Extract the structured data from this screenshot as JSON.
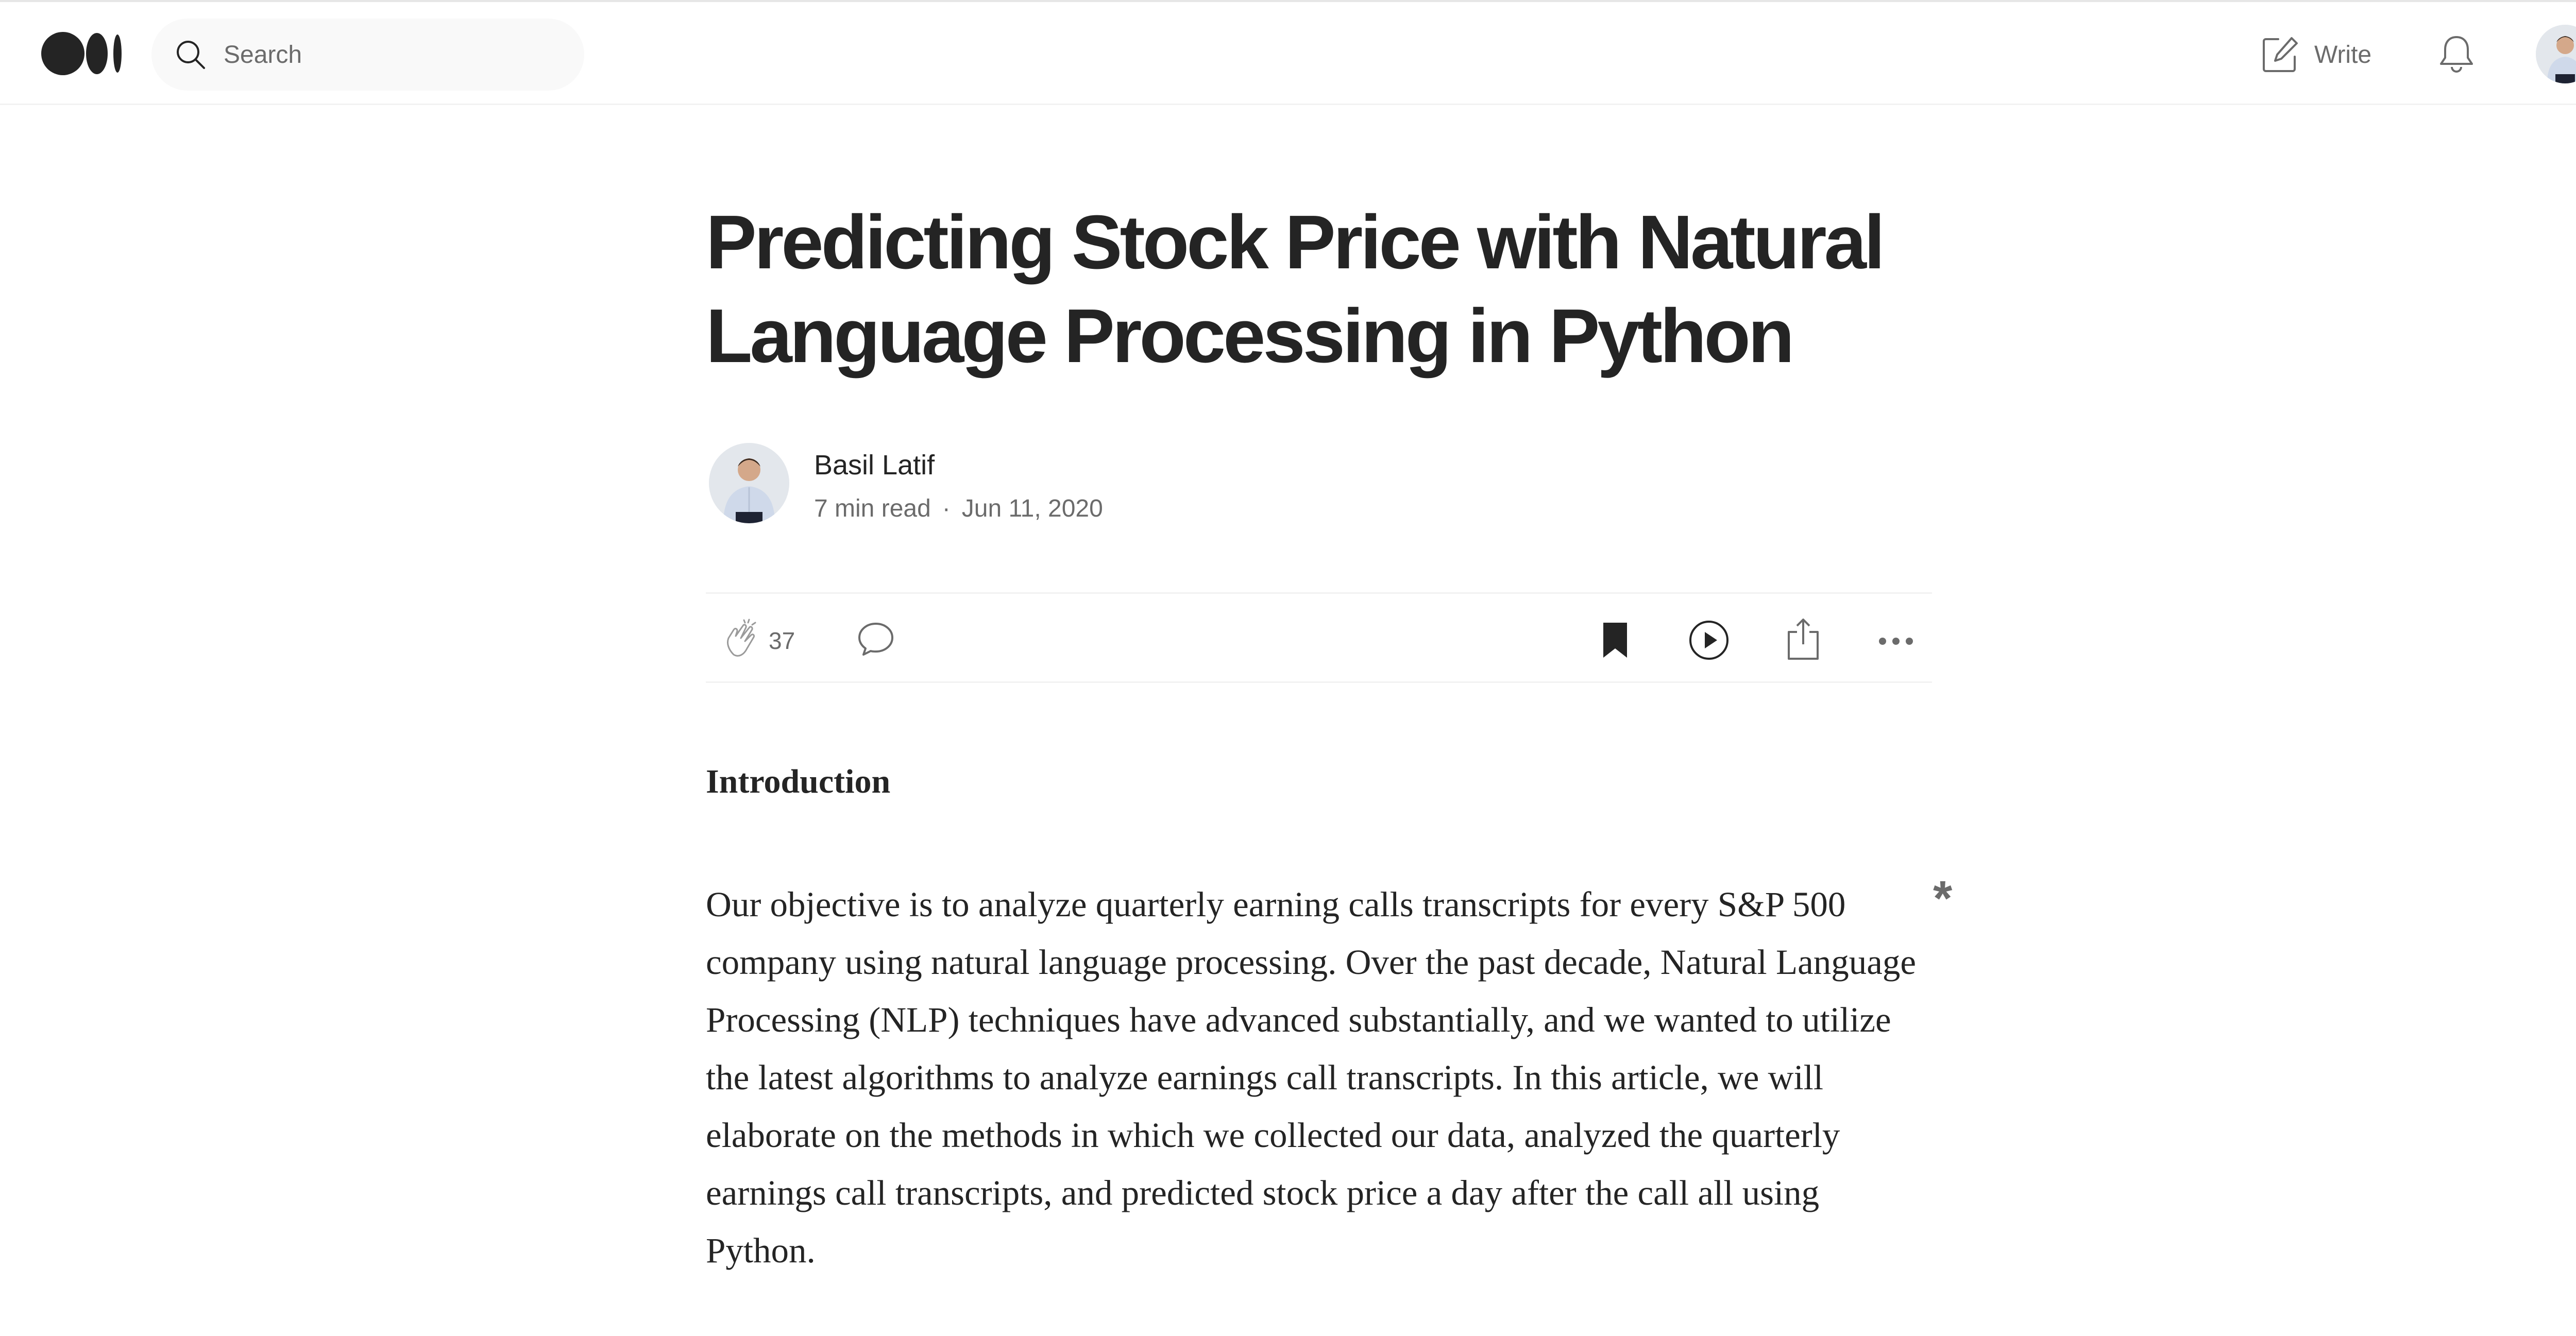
{
  "search": {
    "placeholder": "Search"
  },
  "header": {
    "write_label": "Write"
  },
  "article": {
    "title": "Predicting Stock Price with Natural Language Processing in Python",
    "author": "Basil Latif",
    "read_time": "7 min read",
    "separator": "·",
    "date": "Jun 11, 2020",
    "clap_count": "37",
    "section_heading": "Introduction",
    "paragraph": "Our objective is to analyze quarterly earning calls transcripts for every S&P 500 company using natural language processing. Over the past decade, Natural Language Processing (NLP) techniques have advanced substantially, and we wanted to utilize the latest algorithms to analyze earnings call transcripts. In this article, we will elaborate on the methods in which we collected our data, analyzed the quarterly earnings call transcripts, and predicted stock price a day after the call all using Python.",
    "margin_mark": "*"
  },
  "icons": {
    "logo": "medium-logo",
    "search": "search-icon",
    "write": "write-icon",
    "bell": "bell-icon",
    "sparkle": "sparkle-icon",
    "clap": "clap-icon",
    "comment": "comment-icon",
    "bookmark": "bookmark-icon",
    "listen": "play-icon",
    "share": "share-icon",
    "more": "more-icon"
  },
  "colors": {
    "text": "#242424",
    "muted": "#6b6b6b",
    "search_bg": "#f9f9f9",
    "divider": "#f2f2f2",
    "sparkle": "#ffc017"
  }
}
